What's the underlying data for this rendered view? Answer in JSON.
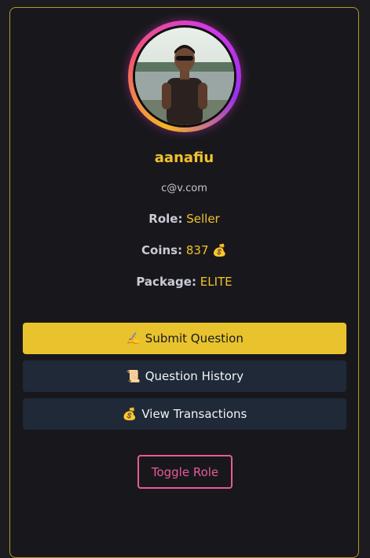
{
  "profile": {
    "username": "aanafiu",
    "email": "c@v.com",
    "avatar_alt": "profile photo"
  },
  "info": {
    "role_label": "Role:",
    "role_value": "Seller",
    "coins_label": "Coins:",
    "coins_value": "837",
    "coins_icon": "💰",
    "package_label": "Package:",
    "package_value": "ELITE"
  },
  "actions": {
    "submit_icon": "✍️",
    "submit_label": "Submit Question",
    "history_icon": "📜",
    "history_label": "Question History",
    "transactions_icon": "💰",
    "transactions_label": "View Transactions",
    "toggle_label": "Toggle Role"
  },
  "colors": {
    "accent": "#f2c12e",
    "primary_button": "#e8c32d",
    "dark_button": "#1f2937",
    "toggle_border": "#e85a9a",
    "card_border": "#b8962a"
  }
}
